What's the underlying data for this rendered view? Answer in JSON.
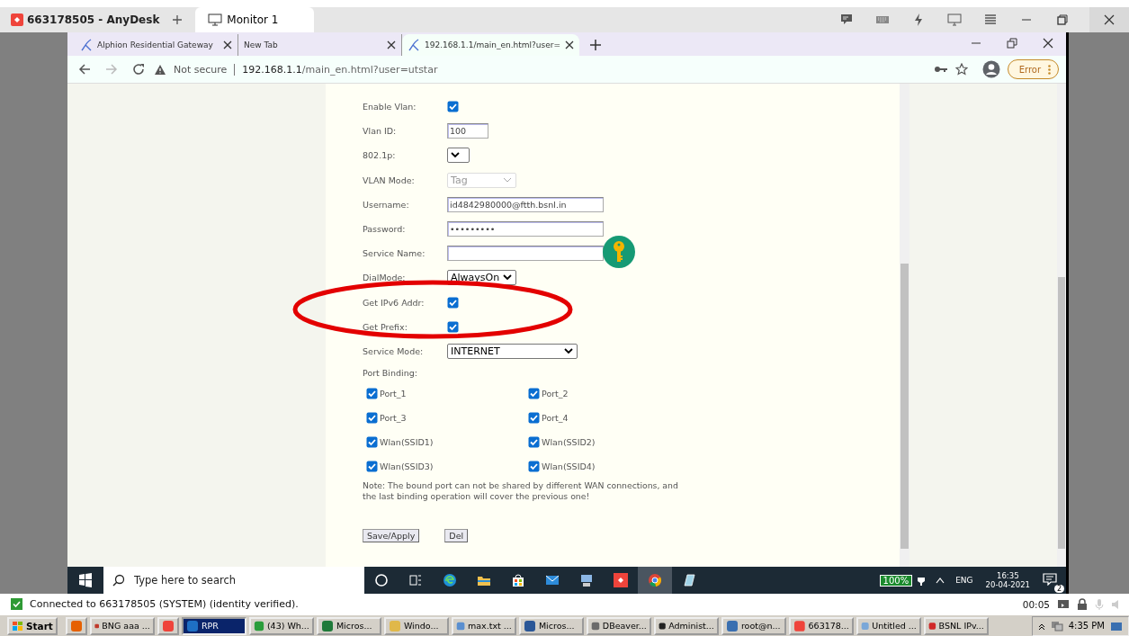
{
  "anydesk": {
    "session_tab": "663178505 - AnyDesk",
    "monitor_tab": "Monitor 1"
  },
  "browser": {
    "tabs": [
      {
        "title": "Alphion Residential Gateway",
        "selected": false
      },
      {
        "title": "New Tab",
        "selected": false
      },
      {
        "title": "192.168.1.1/main_en.html?user=",
        "selected": true
      }
    ],
    "security": "Not secure",
    "host": "192.168.1.1",
    "path": "/main_en.html?user=utstar",
    "profile_badge": "Error"
  },
  "form": {
    "fields": [
      {
        "label": "Enable Vlan:",
        "kind": "checkbox",
        "checked": true
      },
      {
        "label": "Vlan ID:",
        "kind": "text",
        "value": "100"
      },
      {
        "label": "802.1p:",
        "kind": "select"
      },
      {
        "label": "VLAN Mode:",
        "kind": "select",
        "value": "Tag",
        "disabled": true
      },
      {
        "label": "Username:",
        "kind": "text",
        "value": "id4842980000@ftth.bsnl.in"
      },
      {
        "label": "Password:",
        "kind": "text",
        "value": "•••••••••"
      },
      {
        "label": "Service Name:",
        "kind": "text"
      },
      {
        "label": "DialMode:",
        "kind": "select",
        "value": "AlwaysOn"
      },
      {
        "label": "Get IPv6 Addr:",
        "kind": "checkbox",
        "checked": true
      },
      {
        "label": "Get Prefix:",
        "kind": "checkbox",
        "checked": true
      },
      {
        "label": "Service Mode:",
        "kind": "select",
        "value": "INTERNET"
      },
      {
        "label": "Port Binding:",
        "kind": "heading"
      }
    ],
    "port_binding": [
      {
        "label": "Port_1",
        "checked": true
      },
      {
        "label": "Port_2",
        "checked": true
      },
      {
        "label": "Port_3",
        "checked": true
      },
      {
        "label": "Port_4",
        "checked": true
      },
      {
        "label": "Wlan(SSID1)",
        "checked": true
      },
      {
        "label": "Wlan(SSID2)",
        "checked": true
      },
      {
        "label": "Wlan(SSID3)",
        "checked": true
      },
      {
        "label": "Wlan(SSID4)",
        "checked": true
      }
    ],
    "note": "Note: The bound port can not be shared by different WAN connections, and the last binding operation will cover the previous one!",
    "buttons": [
      "Save/Apply",
      "Del"
    ]
  },
  "highlight_ellipse": true,
  "windows_taskbar": {
    "search_placeholder": "Type here to search",
    "battery": "100%",
    "language": "ENG",
    "time": "16:35",
    "date": "20-04-2021",
    "notifications": "2"
  },
  "anydesk_status": {
    "message": "Connected to 663178505 (SYSTEM) (identity verified).",
    "timer": "00:05"
  },
  "host_taskbar": {
    "start": "Start",
    "items": [
      {
        "kind": "icon",
        "selected": false
      },
      {
        "label": "BNG aaa ...",
        "kind": "app",
        "selected": false
      },
      {
        "kind": "icon",
        "selected": false
      },
      {
        "label": "RPR",
        "kind": "app",
        "selected": true
      },
      {
        "label": "(43) Wh...",
        "kind": "app",
        "selected": false
      },
      {
        "label": "Micros...",
        "kind": "app",
        "selected": false
      },
      {
        "label": "Windo...",
        "kind": "app",
        "selected": false
      },
      {
        "label": "max.txt ...",
        "kind": "app",
        "selected": false
      },
      {
        "label": "Micros...",
        "kind": "app",
        "selected": false
      },
      {
        "label": "DBeaver...",
        "kind": "app",
        "selected": false
      },
      {
        "label": "Administ...",
        "kind": "app",
        "selected": false
      },
      {
        "label": "root@n...",
        "kind": "app",
        "selected": false
      },
      {
        "label": "663178...",
        "kind": "app",
        "selected": false
      },
      {
        "label": "Untitled ...",
        "kind": "app",
        "selected": false
      },
      {
        "label": "BSNL IPv...",
        "kind": "app",
        "selected": false
      }
    ],
    "clock": "4:35 PM"
  }
}
